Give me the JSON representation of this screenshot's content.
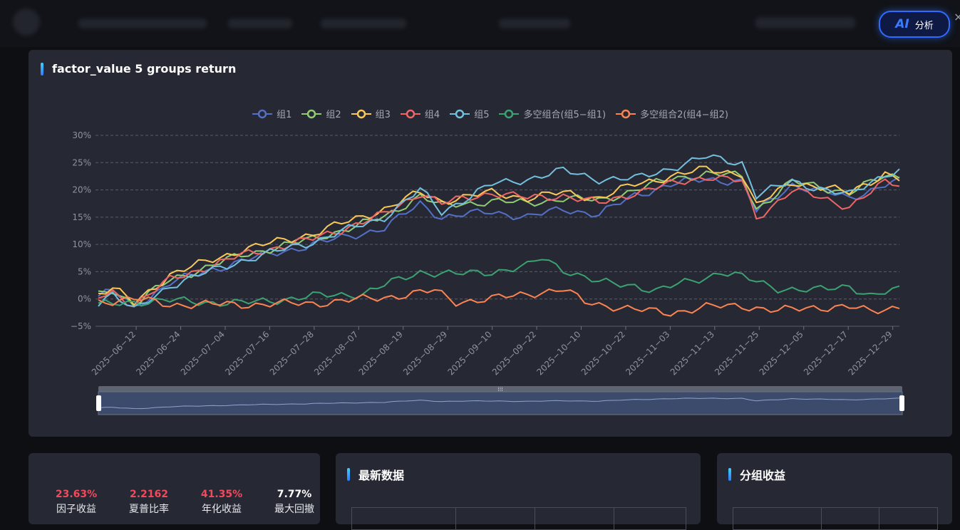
{
  "header": {
    "ai_label": "AI",
    "ai_text": "分析",
    "close": "×"
  },
  "main": {
    "title": "factor_value 5 groups return"
  },
  "chart_data": {
    "type": "line",
    "title": "factor_value 5 groups return",
    "ylim": [
      -5,
      30
    ],
    "yticks": [
      "30%",
      "25%",
      "20%",
      "15%",
      "10%",
      "5%",
      "0%",
      "−5%"
    ],
    "yvals": [
      30,
      25,
      20,
      15,
      10,
      5,
      0,
      -5
    ],
    "x_ticks": [
      "2025−06−12",
      "2025−06−24",
      "2025−07−04",
      "2025−07−16",
      "2025−07−28",
      "2025−08−07",
      "2025−08−19",
      "2025−08−29",
      "2025−09−10",
      "2025−09−22",
      "2025−10−10",
      "2025−10−22",
      "2025−11−03",
      "2025−11−13",
      "2025−11−25",
      "2025−12−05",
      "2025−12−17",
      "2025−12−29"
    ],
    "grid": true,
    "legend_position": "top-center",
    "series": [
      {
        "name": "组1",
        "color": "#5470c6",
        "knots": [
          [
            0,
            0.5
          ],
          [
            2,
            1.5
          ],
          [
            5,
            -1.5
          ],
          [
            10,
            3
          ],
          [
            20,
            7
          ],
          [
            30,
            10
          ],
          [
            40,
            13
          ],
          [
            45,
            17.5
          ],
          [
            48,
            15
          ],
          [
            55,
            16
          ],
          [
            60,
            15
          ],
          [
            65,
            16.5
          ],
          [
            70,
            15.5
          ],
          [
            75,
            19
          ],
          [
            80,
            21
          ],
          [
            85,
            22
          ],
          [
            90,
            21.5
          ],
          [
            92,
            16
          ],
          [
            97,
            21
          ],
          [
            105,
            18.5
          ],
          [
            110,
            21
          ],
          [
            112,
            21.5
          ]
        ]
      },
      {
        "name": "组2",
        "color": "#91cc75",
        "knots": [
          [
            0,
            0.8
          ],
          [
            2,
            1.8
          ],
          [
            5,
            -1
          ],
          [
            10,
            3.5
          ],
          [
            20,
            8
          ],
          [
            30,
            11
          ],
          [
            40,
            15
          ],
          [
            45,
            19
          ],
          [
            48,
            17
          ],
          [
            55,
            18
          ],
          [
            60,
            17.5
          ],
          [
            65,
            18.5
          ],
          [
            70,
            18
          ],
          [
            75,
            20
          ],
          [
            80,
            22
          ],
          [
            85,
            23
          ],
          [
            90,
            22.5
          ],
          [
            92,
            16.5
          ],
          [
            97,
            21.5
          ],
          [
            105,
            19.5
          ],
          [
            110,
            22.5
          ],
          [
            112,
            22.5
          ]
        ]
      },
      {
        "name": "组3",
        "color": "#fac858",
        "knots": [
          [
            0,
            1
          ],
          [
            2,
            2
          ],
          [
            5,
            -0.8
          ],
          [
            10,
            4.5
          ],
          [
            20,
            9
          ],
          [
            30,
            12
          ],
          [
            40,
            16.5
          ],
          [
            45,
            19.5
          ],
          [
            48,
            18
          ],
          [
            55,
            19.5
          ],
          [
            60,
            18.5
          ],
          [
            65,
            19.5
          ],
          [
            70,
            18.5
          ],
          [
            75,
            21
          ],
          [
            80,
            22.5
          ],
          [
            85,
            23.8
          ],
          [
            90,
            23
          ],
          [
            92,
            17
          ],
          [
            97,
            21.5
          ],
          [
            105,
            19.5
          ],
          [
            110,
            23
          ],
          [
            112,
            22
          ]
        ]
      },
      {
        "name": "组4",
        "color": "#ee6666",
        "knots": [
          [
            0,
            0.2
          ],
          [
            2,
            1.2
          ],
          [
            5,
            -1
          ],
          [
            10,
            3.5
          ],
          [
            20,
            8
          ],
          [
            30,
            11
          ],
          [
            40,
            15.5
          ],
          [
            45,
            19.5
          ],
          [
            48,
            17.5
          ],
          [
            55,
            19.5
          ],
          [
            60,
            18.5
          ],
          [
            65,
            19
          ],
          [
            70,
            17.5
          ],
          [
            75,
            19.5
          ],
          [
            80,
            21
          ],
          [
            85,
            22.5
          ],
          [
            90,
            21.5
          ],
          [
            92,
            14.8
          ],
          [
            97,
            20
          ],
          [
            105,
            17
          ],
          [
            110,
            21.3
          ],
          [
            112,
            21
          ]
        ]
      },
      {
        "name": "组5",
        "color": "#73c0de",
        "knots": [
          [
            0,
            -0.5
          ],
          [
            2,
            1
          ],
          [
            5,
            -2.2
          ],
          [
            10,
            2.5
          ],
          [
            20,
            7
          ],
          [
            30,
            10.5
          ],
          [
            40,
            15
          ],
          [
            45,
            20
          ],
          [
            48,
            16
          ],
          [
            55,
            21
          ],
          [
            60,
            22
          ],
          [
            65,
            23.5
          ],
          [
            70,
            22
          ],
          [
            75,
            22
          ],
          [
            80,
            24
          ],
          [
            85,
            26
          ],
          [
            90,
            25
          ],
          [
            92,
            19
          ],
          [
            97,
            21.5
          ],
          [
            105,
            19
          ],
          [
            110,
            23
          ],
          [
            112,
            23.5
          ]
        ]
      },
      {
        "name": "多空组合(组5−组1)",
        "color": "#3ba272",
        "knots": [
          [
            0,
            -1.2
          ],
          [
            5,
            -0.5
          ],
          [
            10,
            -0.3
          ],
          [
            20,
            -0.8
          ],
          [
            30,
            0.5
          ],
          [
            37,
            1
          ],
          [
            42,
            3.5
          ],
          [
            45,
            5
          ],
          [
            50,
            4.5
          ],
          [
            55,
            5
          ],
          [
            60,
            6
          ],
          [
            62,
            7.5
          ],
          [
            65,
            5.5
          ],
          [
            70,
            3
          ],
          [
            75,
            2.5
          ],
          [
            78,
            1.5
          ],
          [
            82,
            3
          ],
          [
            85,
            4
          ],
          [
            87,
            5
          ],
          [
            90,
            4
          ],
          [
            95,
            2
          ],
          [
            100,
            1.5
          ],
          [
            105,
            2.5
          ],
          [
            108,
            0.5
          ],
          [
            112,
            1.7
          ]
        ]
      },
      {
        "name": "多空组合2(组4−组2)",
        "color": "#fc8452",
        "knots": [
          [
            0,
            -0.5
          ],
          [
            5,
            0
          ],
          [
            10,
            -1
          ],
          [
            20,
            -1
          ],
          [
            30,
            -0.8
          ],
          [
            40,
            0.3
          ],
          [
            47,
            1.5
          ],
          [
            50,
            -0.5
          ],
          [
            55,
            0
          ],
          [
            60,
            1
          ],
          [
            65,
            1.7
          ],
          [
            68,
            -0.5
          ],
          [
            75,
            -2
          ],
          [
            80,
            -2.5
          ],
          [
            85,
            -1.5
          ],
          [
            90,
            -1.2
          ],
          [
            95,
            -2.2
          ],
          [
            100,
            -1.5
          ],
          [
            105,
            -1.5
          ],
          [
            108,
            -2.3
          ],
          [
            112,
            -1.3
          ]
        ]
      }
    ]
  },
  "stats": [
    {
      "value": "23.63%",
      "label": "因子收益",
      "color": "#f2495c"
    },
    {
      "value": "2.2162",
      "label": "夏普比率",
      "color": "#f2495c"
    },
    {
      "value": "41.35%",
      "label": "年化收益",
      "color": "#f2495c"
    },
    {
      "value": "7.77%",
      "label": "最大回撤",
      "color": "#ffffff"
    }
  ],
  "panels": {
    "latest": "最新数据",
    "group": "分组收益"
  }
}
